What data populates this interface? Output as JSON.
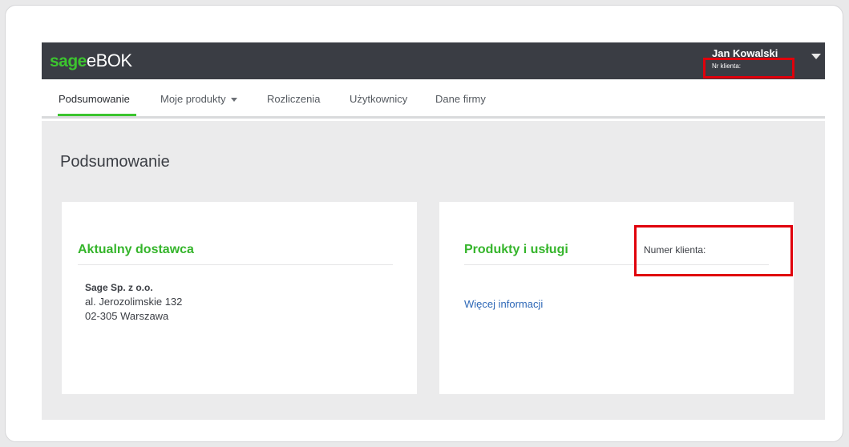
{
  "header": {
    "brand_sage": "sage",
    "brand_app": "eBOK",
    "user_name": "Jan Kowalski",
    "client_number_label": "Nr klienta:"
  },
  "nav": {
    "tabs": [
      {
        "label": "Podsumowanie",
        "active": true
      },
      {
        "label": "Moje produkty",
        "has_dropdown": true
      },
      {
        "label": "Rozliczenia"
      },
      {
        "label": "Użytkownicy"
      },
      {
        "label": "Dane firmy"
      }
    ]
  },
  "main": {
    "page_title": "Podsumowanie",
    "supplier_card": {
      "heading": "Aktualny dostawca",
      "company": "Sage Sp. z o.o.",
      "address_line1": "al. Jerozolimskie 132",
      "address_line2": "02-305 Warszawa"
    },
    "products_card": {
      "heading": "Produkty i usługi",
      "client_number_label": "Numer klienta:",
      "more_link": "Więcej informacji"
    }
  },
  "colors": {
    "brand_green": "#3cc52f",
    "header_bg": "#3a3d44",
    "highlight_red": "#e0000b",
    "link_blue": "#2e68b7"
  }
}
